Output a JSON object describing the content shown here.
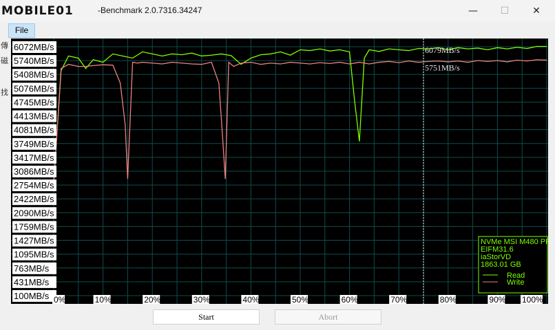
{
  "window": {
    "logo_text": "MOBILE01",
    "title": "-Benchmark 2.0.7316.34247",
    "minimize": "—",
    "maximize": "☐",
    "close": "✕"
  },
  "menu": {
    "file": "File"
  },
  "side_chars": [
    "傳",
    "磁",
    "找"
  ],
  "colors": {
    "read": "#7fff00",
    "write": "#f08080",
    "grid": "#0e4d4d",
    "background": "#000000"
  },
  "chart_data": {
    "type": "line",
    "y_tick_labels": [
      "6072MB/s",
      "5740MB/s",
      "5408MB/s",
      "5076MB/s",
      "4745MB/s",
      "4413MB/s",
      "4081MB/s",
      "3749MB/s",
      "3417MB/s",
      "3086MB/s",
      "2754MB/s",
      "2422MB/s",
      "2090MB/s",
      "1759MB/s",
      "1427MB/s",
      "1095MB/s",
      "763MB/s",
      "431MB/s",
      "100MB/s"
    ],
    "x_tick_labels": [
      "0%",
      "10%",
      "20%",
      "30%",
      "40%",
      "50%",
      "60%",
      "70%",
      "80%",
      "90%",
      "100%"
    ],
    "ylim": [
      100,
      6072
    ],
    "xlim": [
      0,
      100
    ],
    "current_position": 75,
    "current_read_label": "6079MB/s",
    "current_write_label": "5751MB/s",
    "legend": {
      "placement": "bottom-right",
      "lines": [
        "NVMe MSI M480 PR",
        "EIFM31.6",
        "iaStorVD",
        "1863.01 GB"
      ],
      "read": "Read",
      "write": "Write"
    },
    "series": [
      {
        "name": "Read",
        "x": [
          0,
          1.5,
          3,
          5,
          6.5,
          8,
          10,
          12,
          14,
          16,
          18,
          20,
          22,
          24,
          26,
          28,
          30,
          32,
          34,
          36,
          38,
          40,
          42,
          44,
          46,
          48,
          50,
          52,
          54,
          56,
          58,
          60,
          61,
          62,
          63,
          64,
          66,
          68,
          70,
          72,
          74,
          76,
          78,
          80,
          82,
          84,
          86,
          88,
          90,
          92,
          94,
          96,
          98,
          100
        ],
        "values": [
          2800,
          5500,
          5850,
          5800,
          5550,
          5760,
          5700,
          5900,
          5850,
          5800,
          5950,
          5900,
          5850,
          5900,
          5880,
          5920,
          5850,
          5870,
          5900,
          5860,
          5650,
          5800,
          5880,
          5900,
          5950,
          5870,
          6000,
          5980,
          6020,
          5970,
          6000,
          5950,
          4800,
          3800,
          5800,
          6000,
          5960,
          6020,
          6000,
          5980,
          6030,
          6020,
          6050,
          6000,
          6050,
          6020,
          6040,
          6000,
          6050,
          6020,
          6060,
          6030,
          6080,
          6079
        ]
      },
      {
        "name": "Write",
        "x": [
          0,
          1.5,
          3,
          5,
          6.5,
          8,
          10,
          12,
          13.5,
          14.5,
          15,
          16,
          17,
          18,
          20,
          22,
          24,
          26,
          28,
          30,
          32,
          33.5,
          34.2,
          34.8,
          35.5,
          36.5,
          38,
          40,
          42,
          44,
          46,
          48,
          50,
          52,
          54,
          56,
          58,
          60,
          62,
          64,
          66,
          68,
          70,
          72,
          74,
          76,
          78,
          80,
          82,
          84,
          86,
          88,
          90,
          92,
          94,
          96,
          98,
          100
        ],
        "values": [
          2800,
          5550,
          5650,
          5600,
          5600,
          5620,
          5640,
          5630,
          5200,
          4200,
          2900,
          5700,
          5680,
          5700,
          5680,
          5660,
          5700,
          5680,
          5660,
          5650,
          5700,
          5200,
          4000,
          2900,
          5700,
          5600,
          5680,
          5700,
          5650,
          5680,
          5660,
          5700,
          5680,
          5660,
          5690,
          5670,
          5700,
          5660,
          5700,
          5660,
          5700,
          5720,
          5690,
          5730,
          5700,
          5720,
          5730,
          5710,
          5730,
          5700,
          5740,
          5720,
          5740,
          5710,
          5750,
          5730,
          5760,
          5751
        ]
      }
    ]
  },
  "buttons": {
    "start": "Start",
    "abort": "Abort"
  }
}
